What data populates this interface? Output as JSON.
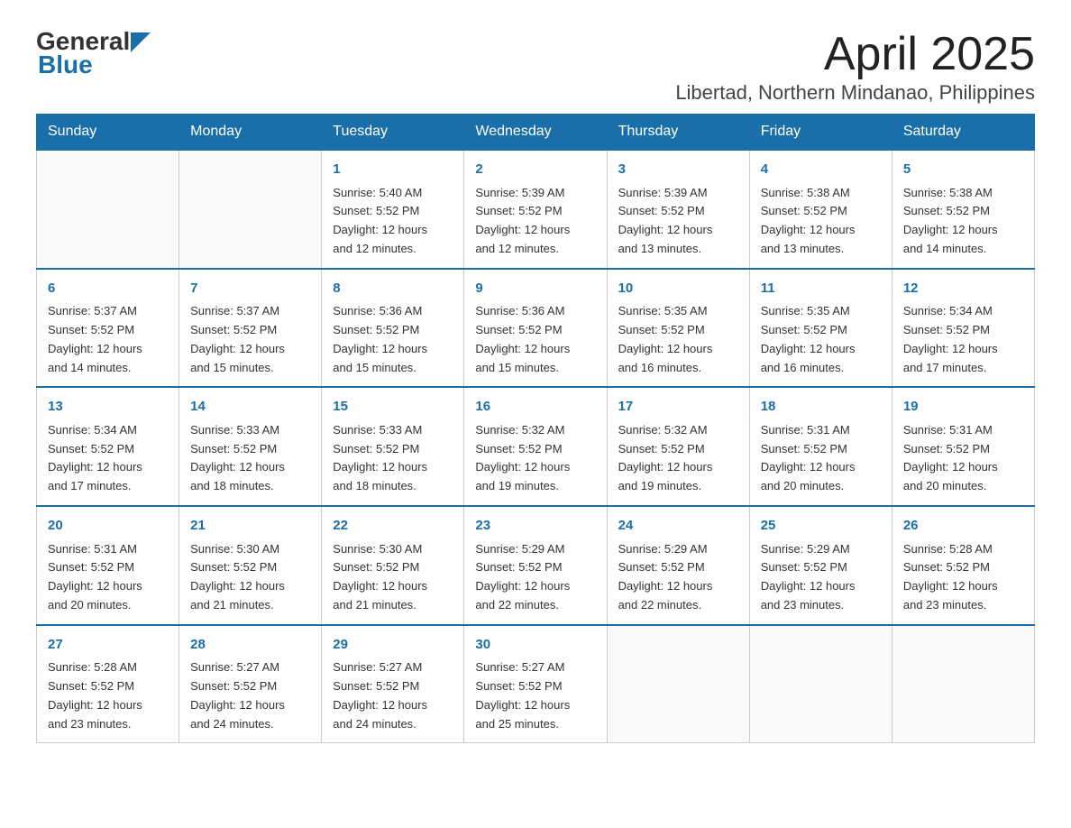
{
  "header": {
    "logo_general": "General",
    "logo_blue": "Blue",
    "title": "April 2025",
    "location": "Libertad, Northern Mindanao, Philippines"
  },
  "days_of_week": [
    "Sunday",
    "Monday",
    "Tuesday",
    "Wednesday",
    "Thursday",
    "Friday",
    "Saturday"
  ],
  "weeks": [
    [
      {
        "day": "",
        "info": ""
      },
      {
        "day": "",
        "info": ""
      },
      {
        "day": "1",
        "info": "Sunrise: 5:40 AM\nSunset: 5:52 PM\nDaylight: 12 hours\nand 12 minutes."
      },
      {
        "day": "2",
        "info": "Sunrise: 5:39 AM\nSunset: 5:52 PM\nDaylight: 12 hours\nand 12 minutes."
      },
      {
        "day": "3",
        "info": "Sunrise: 5:39 AM\nSunset: 5:52 PM\nDaylight: 12 hours\nand 13 minutes."
      },
      {
        "day": "4",
        "info": "Sunrise: 5:38 AM\nSunset: 5:52 PM\nDaylight: 12 hours\nand 13 minutes."
      },
      {
        "day": "5",
        "info": "Sunrise: 5:38 AM\nSunset: 5:52 PM\nDaylight: 12 hours\nand 14 minutes."
      }
    ],
    [
      {
        "day": "6",
        "info": "Sunrise: 5:37 AM\nSunset: 5:52 PM\nDaylight: 12 hours\nand 14 minutes."
      },
      {
        "day": "7",
        "info": "Sunrise: 5:37 AM\nSunset: 5:52 PM\nDaylight: 12 hours\nand 15 minutes."
      },
      {
        "day": "8",
        "info": "Sunrise: 5:36 AM\nSunset: 5:52 PM\nDaylight: 12 hours\nand 15 minutes."
      },
      {
        "day": "9",
        "info": "Sunrise: 5:36 AM\nSunset: 5:52 PM\nDaylight: 12 hours\nand 15 minutes."
      },
      {
        "day": "10",
        "info": "Sunrise: 5:35 AM\nSunset: 5:52 PM\nDaylight: 12 hours\nand 16 minutes."
      },
      {
        "day": "11",
        "info": "Sunrise: 5:35 AM\nSunset: 5:52 PM\nDaylight: 12 hours\nand 16 minutes."
      },
      {
        "day": "12",
        "info": "Sunrise: 5:34 AM\nSunset: 5:52 PM\nDaylight: 12 hours\nand 17 minutes."
      }
    ],
    [
      {
        "day": "13",
        "info": "Sunrise: 5:34 AM\nSunset: 5:52 PM\nDaylight: 12 hours\nand 17 minutes."
      },
      {
        "day": "14",
        "info": "Sunrise: 5:33 AM\nSunset: 5:52 PM\nDaylight: 12 hours\nand 18 minutes."
      },
      {
        "day": "15",
        "info": "Sunrise: 5:33 AM\nSunset: 5:52 PM\nDaylight: 12 hours\nand 18 minutes."
      },
      {
        "day": "16",
        "info": "Sunrise: 5:32 AM\nSunset: 5:52 PM\nDaylight: 12 hours\nand 19 minutes."
      },
      {
        "day": "17",
        "info": "Sunrise: 5:32 AM\nSunset: 5:52 PM\nDaylight: 12 hours\nand 19 minutes."
      },
      {
        "day": "18",
        "info": "Sunrise: 5:31 AM\nSunset: 5:52 PM\nDaylight: 12 hours\nand 20 minutes."
      },
      {
        "day": "19",
        "info": "Sunrise: 5:31 AM\nSunset: 5:52 PM\nDaylight: 12 hours\nand 20 minutes."
      }
    ],
    [
      {
        "day": "20",
        "info": "Sunrise: 5:31 AM\nSunset: 5:52 PM\nDaylight: 12 hours\nand 20 minutes."
      },
      {
        "day": "21",
        "info": "Sunrise: 5:30 AM\nSunset: 5:52 PM\nDaylight: 12 hours\nand 21 minutes."
      },
      {
        "day": "22",
        "info": "Sunrise: 5:30 AM\nSunset: 5:52 PM\nDaylight: 12 hours\nand 21 minutes."
      },
      {
        "day": "23",
        "info": "Sunrise: 5:29 AM\nSunset: 5:52 PM\nDaylight: 12 hours\nand 22 minutes."
      },
      {
        "day": "24",
        "info": "Sunrise: 5:29 AM\nSunset: 5:52 PM\nDaylight: 12 hours\nand 22 minutes."
      },
      {
        "day": "25",
        "info": "Sunrise: 5:29 AM\nSunset: 5:52 PM\nDaylight: 12 hours\nand 23 minutes."
      },
      {
        "day": "26",
        "info": "Sunrise: 5:28 AM\nSunset: 5:52 PM\nDaylight: 12 hours\nand 23 minutes."
      }
    ],
    [
      {
        "day": "27",
        "info": "Sunrise: 5:28 AM\nSunset: 5:52 PM\nDaylight: 12 hours\nand 23 minutes."
      },
      {
        "day": "28",
        "info": "Sunrise: 5:27 AM\nSunset: 5:52 PM\nDaylight: 12 hours\nand 24 minutes."
      },
      {
        "day": "29",
        "info": "Sunrise: 5:27 AM\nSunset: 5:52 PM\nDaylight: 12 hours\nand 24 minutes."
      },
      {
        "day": "30",
        "info": "Sunrise: 5:27 AM\nSunset: 5:52 PM\nDaylight: 12 hours\nand 25 minutes."
      },
      {
        "day": "",
        "info": ""
      },
      {
        "day": "",
        "info": ""
      },
      {
        "day": "",
        "info": ""
      }
    ]
  ]
}
